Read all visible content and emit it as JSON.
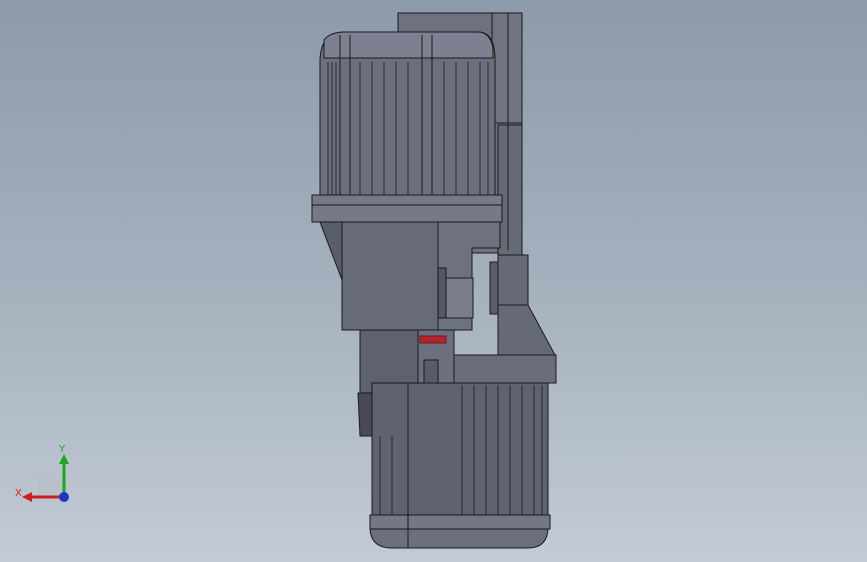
{
  "viewport": {
    "background_top": "#8c9aa9",
    "background_bottom": "#c3cbd4"
  },
  "triad": {
    "x_label": "X",
    "y_label": "Y",
    "x_color": "#cc1f1f",
    "y_color": "#1fa51f",
    "z_color": "#2233cc"
  },
  "model": {
    "body_color": "#6a6e7c",
    "dark_color": "#4a4d58",
    "light_color": "#8a8e9c",
    "edge_color": "#1a1a1a",
    "accent_color": "#b0242a"
  }
}
